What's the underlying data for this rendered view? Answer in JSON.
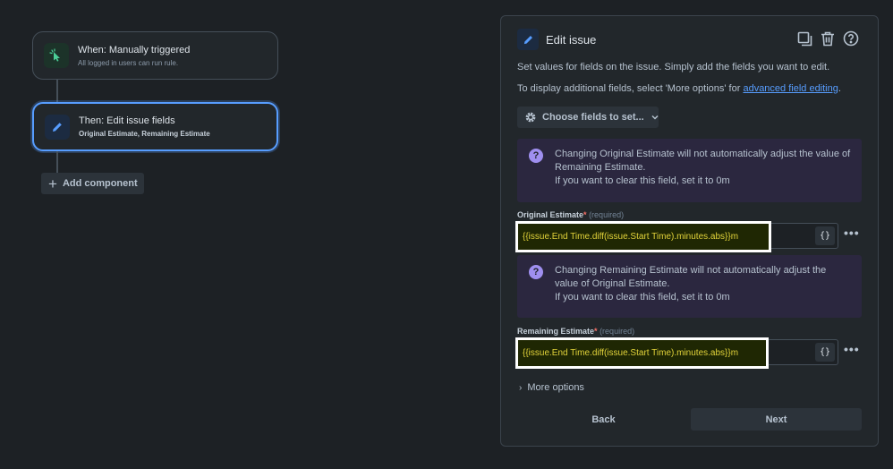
{
  "canvas": {
    "trigger": {
      "title": "When: Manually triggered",
      "subtitle": "All logged in users can run rule.",
      "icon": "cursor-click-icon"
    },
    "action": {
      "title": "Then: Edit issue fields",
      "subtitle": "Original Estimate, Remaining Estimate",
      "icon": "pencil-icon"
    },
    "add_component_label": "Add component"
  },
  "panel": {
    "title": "Edit issue",
    "desc1": "Set values for fields on the issue. Simply add the fields you want to edit.",
    "desc2_prefix": "To display additional fields, select 'More options' for ",
    "desc2_link": "advanced field editing",
    "desc2_suffix": ".",
    "choose_fields_label": "Choose fields to set...",
    "info1": {
      "line1": "Changing Original Estimate will not automatically adjust the value of Remaining Estimate.",
      "line2": "If you want to clear this field, set it to 0m"
    },
    "field1": {
      "label": "Original Estimate",
      "star": "*",
      "required": "(required)",
      "value": "{{issue.End Time.diff(issue.Start Time).minutes.abs}}m"
    },
    "info2": {
      "line1": "Changing Remaining Estimate will not automatically adjust the value of Original Estimate.",
      "line2": "If you want to clear this field, set it to 0m"
    },
    "field2": {
      "label": "Remaining Estimate",
      "star": "*",
      "required": "(required)",
      "value": "{{issue.End Time.diff(issue.Start Time).minutes.abs}}m"
    },
    "brace_label": "{}",
    "more_dots": "•••",
    "more_options_label": "More options",
    "back_label": "Back",
    "next_label": "Next"
  },
  "colors": {
    "background": "#1d2125",
    "accent": "#579dff",
    "info_bg": "#2b273f",
    "smart_value_text": "#e2d33a"
  }
}
